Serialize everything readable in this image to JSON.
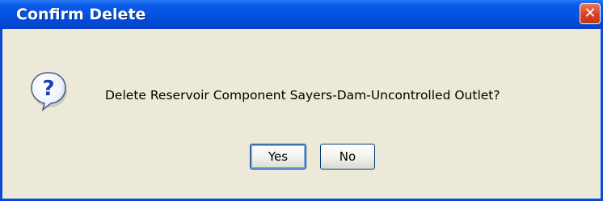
{
  "dialog": {
    "title": "Confirm Delete",
    "close_symbol": "✕",
    "icon": "question-icon",
    "message": "Delete Reservoir Component Sayers-Dam-Uncontrolled Outlet?",
    "buttons": {
      "yes_label": "Yes",
      "no_label": "No"
    }
  },
  "colors": {
    "titlebar": "#0552e0",
    "body": "#ece9d8",
    "close_button": "#d8462a",
    "icon_question_mark": "#1a3fb8"
  }
}
